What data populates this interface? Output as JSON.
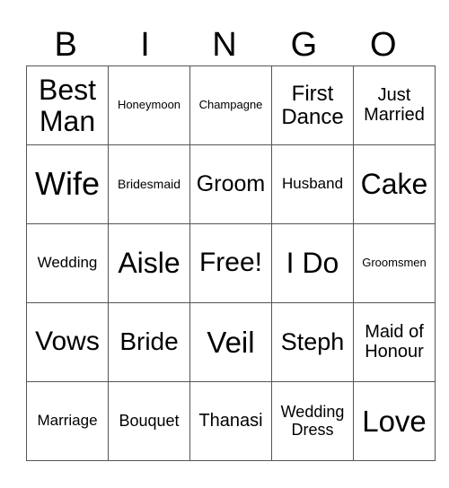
{
  "title_letters": [
    "B",
    "I",
    "N",
    "G",
    "O"
  ],
  "rows": [
    [
      {
        "text": "Best Man",
        "size": 32
      },
      {
        "text": "Honeymoon",
        "size": 13
      },
      {
        "text": "Champagne",
        "size": 13
      },
      {
        "text": "First Dance",
        "size": 24
      },
      {
        "text": "Just Married",
        "size": 20
      }
    ],
    [
      {
        "text": "Wife",
        "size": 36
      },
      {
        "text": "Bridesmaid",
        "size": 14
      },
      {
        "text": "Groom",
        "size": 25
      },
      {
        "text": "Husband",
        "size": 17
      },
      {
        "text": "Cake",
        "size": 32
      }
    ],
    [
      {
        "text": "Wedding",
        "size": 17
      },
      {
        "text": "Aisle",
        "size": 32
      },
      {
        "text": "Free!",
        "size": 30
      },
      {
        "text": "I Do",
        "size": 32
      },
      {
        "text": "Groomsmen",
        "size": 13
      }
    ],
    [
      {
        "text": "Vows",
        "size": 30
      },
      {
        "text": "Bride",
        "size": 28
      },
      {
        "text": "Veil",
        "size": 33
      },
      {
        "text": "Steph",
        "size": 27
      },
      {
        "text": "Maid of Honour",
        "size": 20
      }
    ],
    [
      {
        "text": "Marriage",
        "size": 17
      },
      {
        "text": "Bouquet",
        "size": 18
      },
      {
        "text": "Thanasi",
        "size": 20
      },
      {
        "text": "Wedding Dress",
        "size": 18
      },
      {
        "text": "Love",
        "size": 33
      }
    ]
  ]
}
